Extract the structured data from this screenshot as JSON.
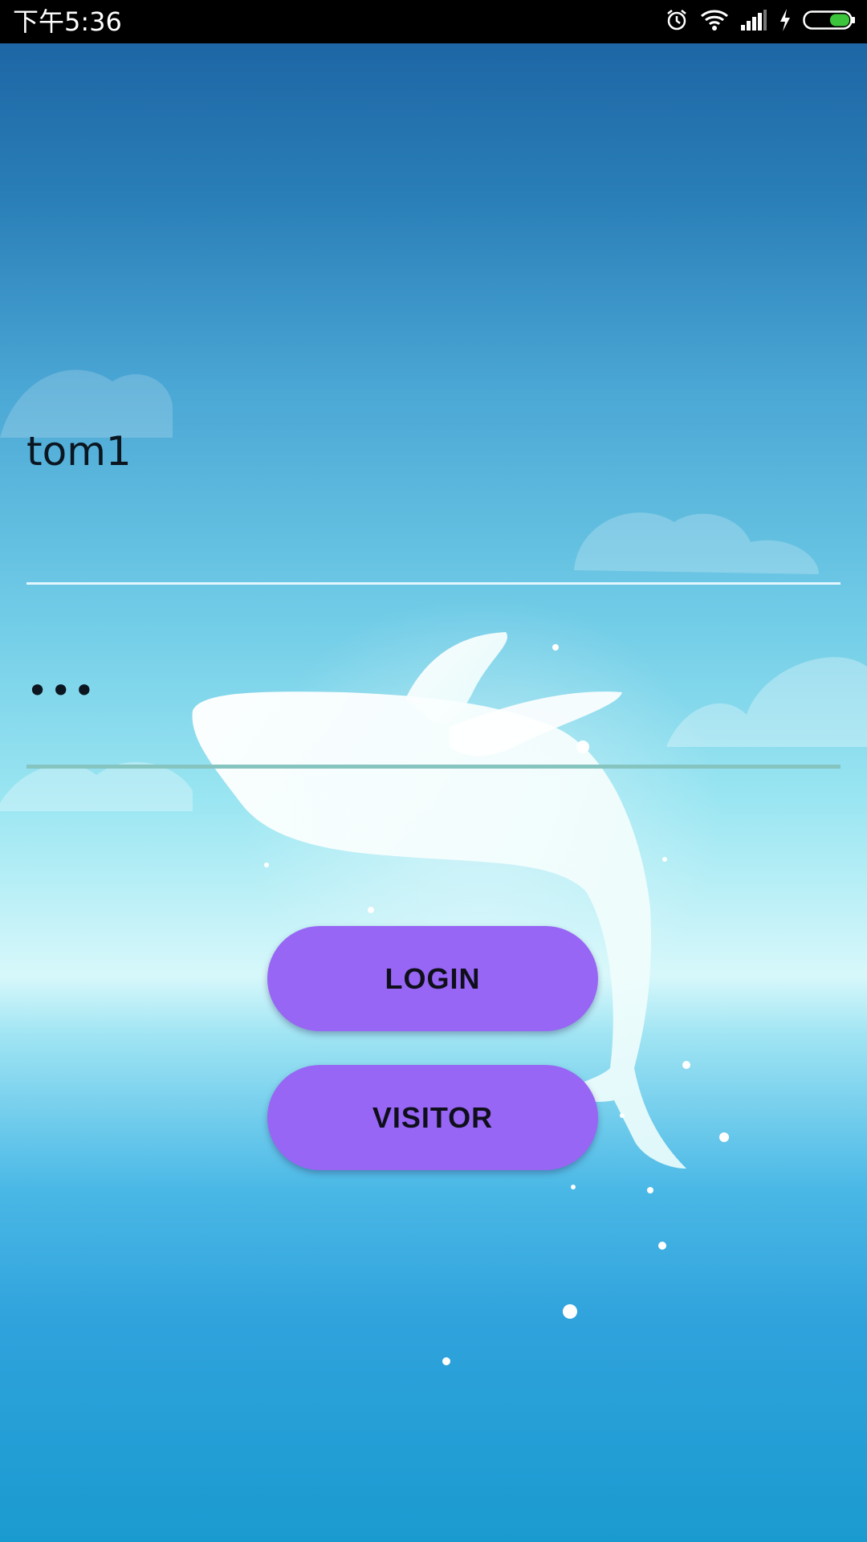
{
  "status_bar": {
    "time": "下午5:36",
    "icons": [
      "alarm-icon",
      "wifi-icon",
      "signal-icon",
      "charging-icon",
      "battery-icon"
    ],
    "battery_color": "#3cc43c"
  },
  "login_form": {
    "username_value": "tom1",
    "password_value": "•••",
    "username_underline_color": "#e6f6ff",
    "password_underline_color": "#86c4c0"
  },
  "buttons": {
    "login_label": "LOGIN",
    "visitor_label": "VISITOR",
    "color": "#9766f4"
  }
}
